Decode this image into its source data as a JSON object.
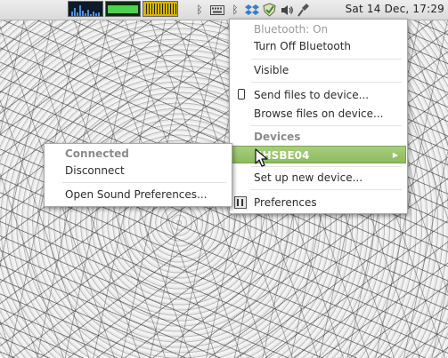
{
  "panel": {
    "clock": "Sat 14 Dec, 17:29",
    "tray_icons": [
      "bluetooth-icon",
      "keyboard-icon",
      "bluetooth-icon",
      "dropbox-icon",
      "shield-check-icon",
      "volume-icon",
      "network-icon"
    ],
    "monitors": [
      "cpu-monitor",
      "memory-monitor",
      "network-monitor"
    ]
  },
  "bluetooth_menu": {
    "status": "Bluetooth: On",
    "turn_off": "Turn Off Bluetooth",
    "visible": "Visible",
    "send_files": "Send files to device...",
    "browse_files": "Browse files on device...",
    "devices_header": "Devices",
    "device_name": "SHSBE04",
    "setup_new": "Set up new device...",
    "preferences": "Preferences"
  },
  "device_submenu": {
    "status": "Connected",
    "disconnect": "Disconnect",
    "sound_prefs": "Open Sound Preferences..."
  },
  "colors": {
    "selection": "#8cbb5d",
    "panel_bg": "#e2e2e2"
  }
}
